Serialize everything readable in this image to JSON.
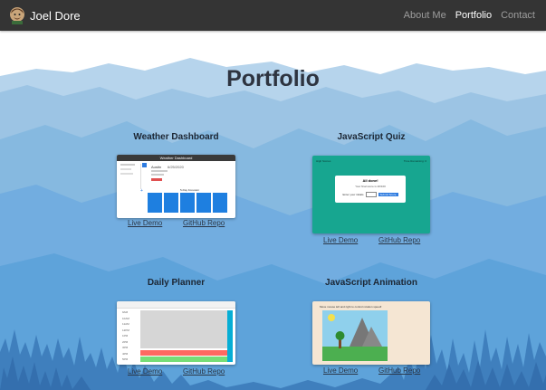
{
  "nav": {
    "brand": "Joel Dore",
    "links": [
      {
        "label": "About Me",
        "active": false
      },
      {
        "label": "Portfolio",
        "active": true
      },
      {
        "label": "Contact",
        "active": false
      }
    ]
  },
  "page": {
    "title": "Portfolio"
  },
  "projects": [
    {
      "title": "Weather Dashboard",
      "demo_label": "Live Demo",
      "repo_label": "GitHub Repo",
      "thumbnail": {
        "header": "Weather Dashboard",
        "city": "Austin",
        "date": "6/25/2020",
        "forecast_title": "5-Day Forecast:"
      }
    },
    {
      "title": "JavaScript Quiz",
      "demo_label": "Live Demo",
      "repo_label": "GitHub Repo",
      "thumbnail": {
        "left_label": "High Scores",
        "right_label": "Time Remaining: 0",
        "modal_title": "All done!",
        "modal_text": "Your final score is 20/100",
        "input_label": "Enter your initials",
        "submit_label": "Submit Score"
      }
    },
    {
      "title": "Daily Planner",
      "demo_label": "Live Demo",
      "repo_label": "GitHub Repo",
      "thumbnail": {
        "hours": [
          "9AM",
          "10AM",
          "11AM",
          "12PM",
          "1PM",
          "2PM",
          "3PM",
          "4PM",
          "5PM"
        ]
      }
    },
    {
      "title": "JavaScript Animation",
      "demo_label": "Live Demo",
      "repo_label": "GitHub Repo",
      "thumbnail": {
        "caption": "Move mouse left and right to control rotation speed!"
      }
    }
  ],
  "colors": {
    "navbar": "#343434",
    "title": "#2e3440",
    "sky": "#ffffff",
    "mountain_far": "#9cc4e4",
    "mountain_mid": "#7fb3dd",
    "mountain_near": "#5aa1d6",
    "trees": "#3b78b5"
  }
}
